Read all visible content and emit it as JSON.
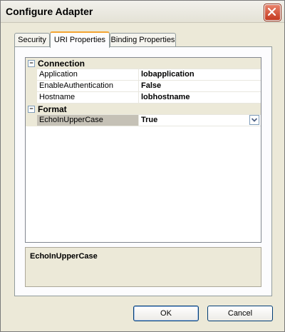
{
  "window": {
    "title": "Configure Adapter"
  },
  "tabs": [
    {
      "label": "Security"
    },
    {
      "label": "URI Properties"
    },
    {
      "label": "Binding Properties"
    }
  ],
  "grid": {
    "categories": [
      {
        "label": "Connection",
        "expander": "−",
        "properties": [
          {
            "name": "Application",
            "value": "lobapplication"
          },
          {
            "name": "EnableAuthentication",
            "value": "False"
          },
          {
            "name": "Hostname",
            "value": "lobhostname"
          }
        ]
      },
      {
        "label": "Format",
        "expander": "−",
        "properties": [
          {
            "name": "EchoInUpperCase",
            "value": "True"
          }
        ]
      }
    ]
  },
  "description": {
    "title": "EchoInUpperCase"
  },
  "buttons": {
    "ok": "OK",
    "cancel": "Cancel"
  }
}
